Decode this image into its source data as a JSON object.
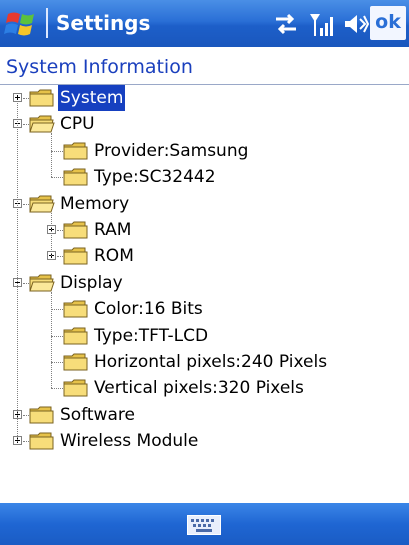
{
  "titlebar": {
    "title": "Settings",
    "ok_label": "ok"
  },
  "heading": "System Information",
  "tree": [
    {
      "label": "System",
      "expander": "plus",
      "selected": true
    },
    {
      "label": "CPU",
      "expander": "minus",
      "selected": false
    },
    {
      "label": "Provider:Samsung",
      "expander": null,
      "selected": false
    },
    {
      "label": "Type:SC32442",
      "expander": null,
      "selected": false
    },
    {
      "label": "Memory",
      "expander": "minus",
      "selected": false
    },
    {
      "label": "RAM",
      "expander": "plus",
      "selected": false
    },
    {
      "label": "ROM",
      "expander": "plus",
      "selected": false
    },
    {
      "label": "Display",
      "expander": "minus",
      "selected": false
    },
    {
      "label": "Color:16 Bits",
      "expander": null,
      "selected": false
    },
    {
      "label": "Type:TFT-LCD",
      "expander": null,
      "selected": false
    },
    {
      "label": "Horizontal pixels:240 Pixels",
      "expander": null,
      "selected": false
    },
    {
      "label": "Vertical pixels:320 Pixels",
      "expander": null,
      "selected": false
    },
    {
      "label": "Software",
      "expander": "plus",
      "selected": false
    },
    {
      "label": "Wireless Module",
      "expander": "plus",
      "selected": false
    }
  ],
  "status_icons": [
    "connectivity-icon",
    "signal-icon",
    "volume-icon"
  ],
  "colors": {
    "titlebar": "#2a6fd6",
    "selection": "#1640c0",
    "heading_text": "#1a3fbd",
    "folder": "#f2d16a"
  }
}
